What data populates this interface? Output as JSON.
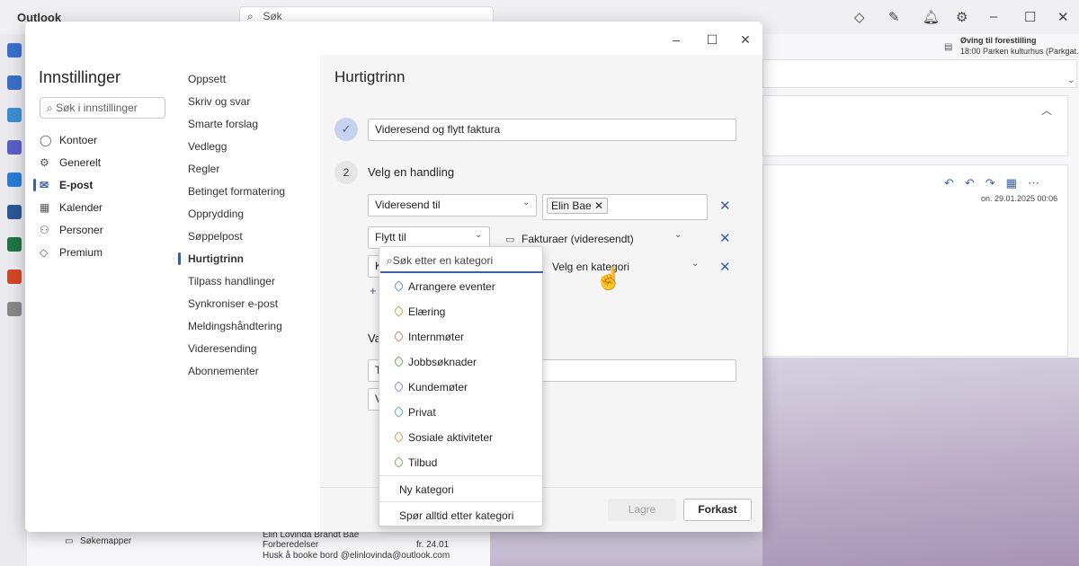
{
  "app": {
    "title": "Outlook",
    "search_placeholder": "Søk"
  },
  "calendar_event": {
    "title": "Øving til forestilling",
    "details": "18:00 Parken kulturhus (Parkgat..."
  },
  "mail_preview": {
    "date": "on. 29.01.2025 00:06"
  },
  "bg_list": {
    "search_folders": "Søkemapper",
    "sender": "Elin Lovinda Brandt Bae",
    "subject": "Forberedelser",
    "date": "fr. 24.01",
    "preview": "Husk å booke bord @elinlovinda@outlook.com"
  },
  "settings": {
    "title": "Innstillinger",
    "search_placeholder": "Søk i innstillinger",
    "nav": [
      {
        "label": "Kontoer",
        "icon": "person-icon"
      },
      {
        "label": "Generelt",
        "icon": "gear-icon"
      },
      {
        "label": "E-post",
        "icon": "mail-icon",
        "active": true
      },
      {
        "label": "Kalender",
        "icon": "calendar-icon"
      },
      {
        "label": "Personer",
        "icon": "people-icon"
      },
      {
        "label": "Premium",
        "icon": "diamond-icon"
      }
    ],
    "subnav": [
      "Oppsett",
      "Skriv og svar",
      "Smarte forslag",
      "Vedlegg",
      "Regler",
      "Betinget formatering",
      "Opprydding",
      "Søppelpost",
      "Hurtigtrinn",
      "Tilpass handlinger",
      "Synkroniser e-post",
      "Meldingshåndtering",
      "Videresending",
      "Abonnementer"
    ],
    "active_subnav": "Hurtigtrinn"
  },
  "quickstep": {
    "title": "Hurtigtrinn",
    "name_value": "Videresend og flytt faktura",
    "step2_number": "2",
    "step2_label": "Velg en handling",
    "action1": "Videresend til",
    "recipient_chip": "Elin Bae",
    "action2": "Flytt til",
    "folder": "Fakturaer (videresendt)",
    "action3_partial": "K",
    "category_placeholder": "Velg en kategori",
    "section_partial": "Va",
    "field_partial_1": "T",
    "field_partial_2": "V"
  },
  "dropdown": {
    "search_placeholder": "Søk etter en kategori",
    "categories": [
      {
        "label": "Arrangere eventer",
        "color": "#6b8fd6"
      },
      {
        "label": "Elæring",
        "color": "#d4a64a"
      },
      {
        "label": "Internmøter",
        "color": "#d9866a"
      },
      {
        "label": "Jobbsøknader",
        "color": "#6fae5c"
      },
      {
        "label": "Kundemøter",
        "color": "#9a86d6"
      },
      {
        "label": "Privat",
        "color": "#5fb3a3"
      },
      {
        "label": "Sosiale aktiviteter",
        "color": "#d9a05f"
      },
      {
        "label": "Tilbud",
        "color": "#7fb35f"
      }
    ],
    "new_category": "Ny kategori",
    "always_ask": "Spør alltid etter kategori"
  },
  "footer": {
    "save": "Lagre",
    "discard": "Forkast"
  },
  "colors": {
    "accent": "#3b5ea8",
    "content_bg": "#f5f5f5"
  }
}
